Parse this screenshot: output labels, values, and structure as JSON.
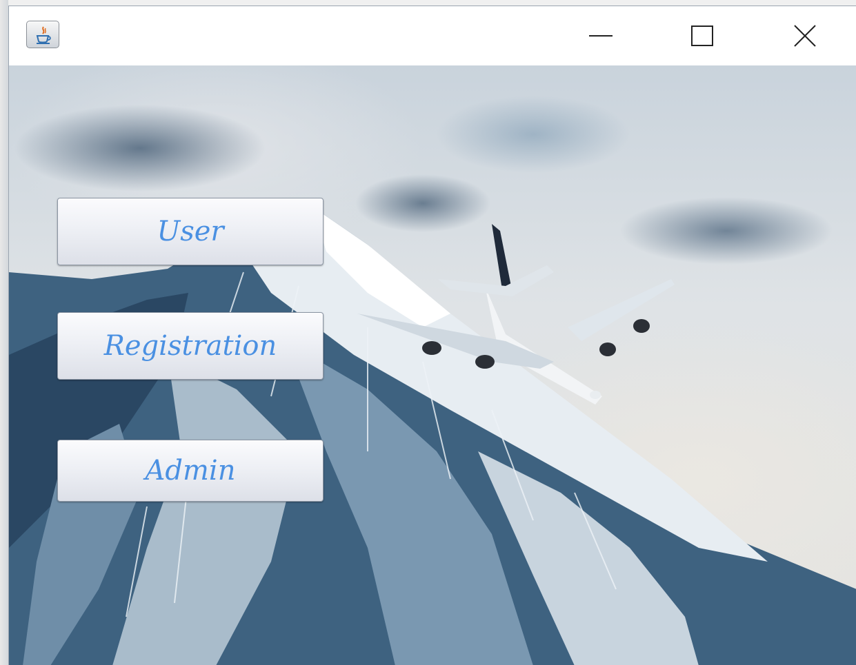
{
  "window": {
    "app_icon": "java-coffee-cup-icon",
    "controls": {
      "minimize": "minimize-icon",
      "maximize": "maximize-icon",
      "close": "close-icon"
    }
  },
  "main": {
    "background": "airplane-over-snowy-mountain-image",
    "buttons": {
      "user_label": "User",
      "registration_label": "Registration",
      "admin_label": "Admin"
    }
  },
  "colors": {
    "button_text": "#4a90e2",
    "title_bar": "#ffffff"
  }
}
